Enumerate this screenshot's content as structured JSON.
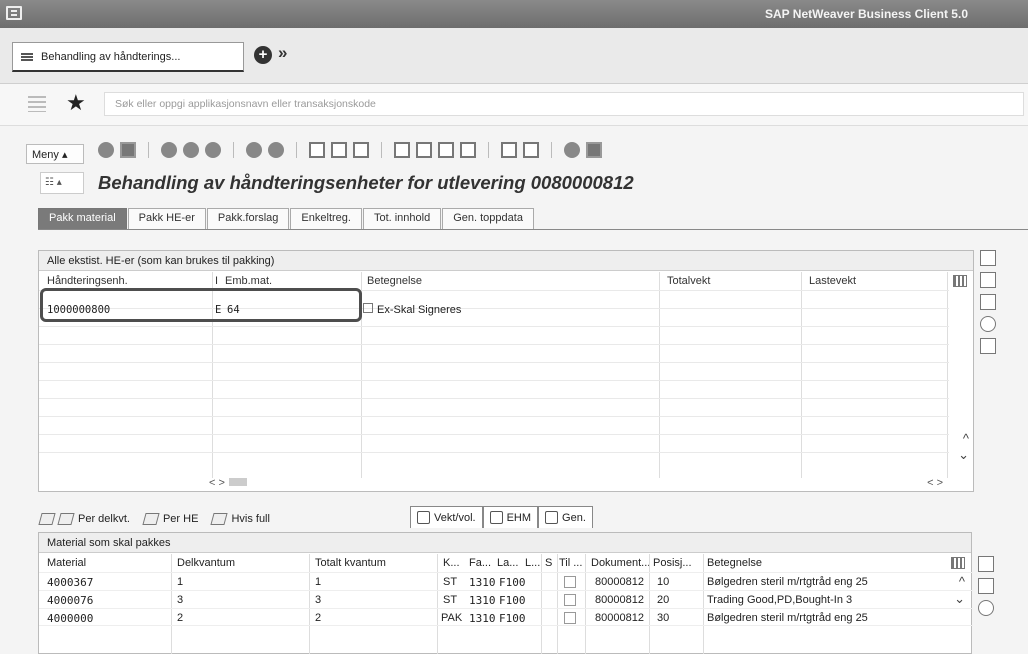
{
  "window": {
    "title": "SAP NetWeaver Business Client 5.0"
  },
  "tabbar": {
    "active_tab": "Behandling av håndterings..."
  },
  "search": {
    "placeholder": "Søk eller oppgi applikasjonsnavn eller transaksjonskode"
  },
  "toolbar": {
    "menu_label": "Meny"
  },
  "screen": {
    "title": "Behandling av håndteringsenheter for utlevering 0080000812"
  },
  "tabs": [
    "Pakk material",
    "Pakk HE-er",
    "Pakk.forslag",
    "Enkeltreg.",
    "Tot. innhold",
    "Gen. toppdata"
  ],
  "upper_table": {
    "title": "Alle ekstist. HE-er (som kan brukes til pakking)",
    "columns": [
      "Håndteringsenh.",
      "I",
      "Emb.mat.",
      "Betegnelse",
      "Totalvekt",
      "Lastevekt"
    ],
    "row": {
      "handling_unit": "1000000800",
      "i": "E",
      "pack_mat": "64",
      "description": "Ex-Skal Signeres"
    }
  },
  "lower_toolbar": {
    "buttons": [
      "Per delkvt.",
      "Per HE",
      "Hvis full"
    ],
    "tabs": [
      "Vekt/vol.",
      "EHM",
      "Gen."
    ]
  },
  "lower_table": {
    "title": "Material som skal pakkes",
    "columns": [
      "Material",
      "Delkvantum",
      "Totalt kvantum",
      "K...",
      "Fa...",
      "La...",
      "L...",
      "S",
      "Til ...",
      "Dokument...",
      "Posisj...",
      "Betegnelse"
    ],
    "rows": [
      {
        "material": "4000367",
        "partial": "1",
        "total": "1",
        "unit": "ST",
        "plant": "1310",
        "storage": "F100",
        "document": "80000812",
        "item": "10",
        "description": "Bølgedren steril m/rtgtråd eng 25"
      },
      {
        "material": "4000076",
        "partial": "3",
        "total": "3",
        "unit": "ST",
        "plant": "1310",
        "storage": "F100",
        "document": "80000812",
        "item": "20",
        "description": "Trading Good,PD,Bought-In 3"
      },
      {
        "material": "4000000",
        "partial": "2",
        "total": "2",
        "unit": "PAK",
        "plant": "1310",
        "storage": "F100",
        "document": "80000812",
        "item": "30",
        "description": "Bølgedren steril m/rtgtråd eng 25"
      }
    ]
  },
  "scroll": {
    "left": "<",
    "right": ">",
    "up": "^",
    "down": "⌄"
  }
}
